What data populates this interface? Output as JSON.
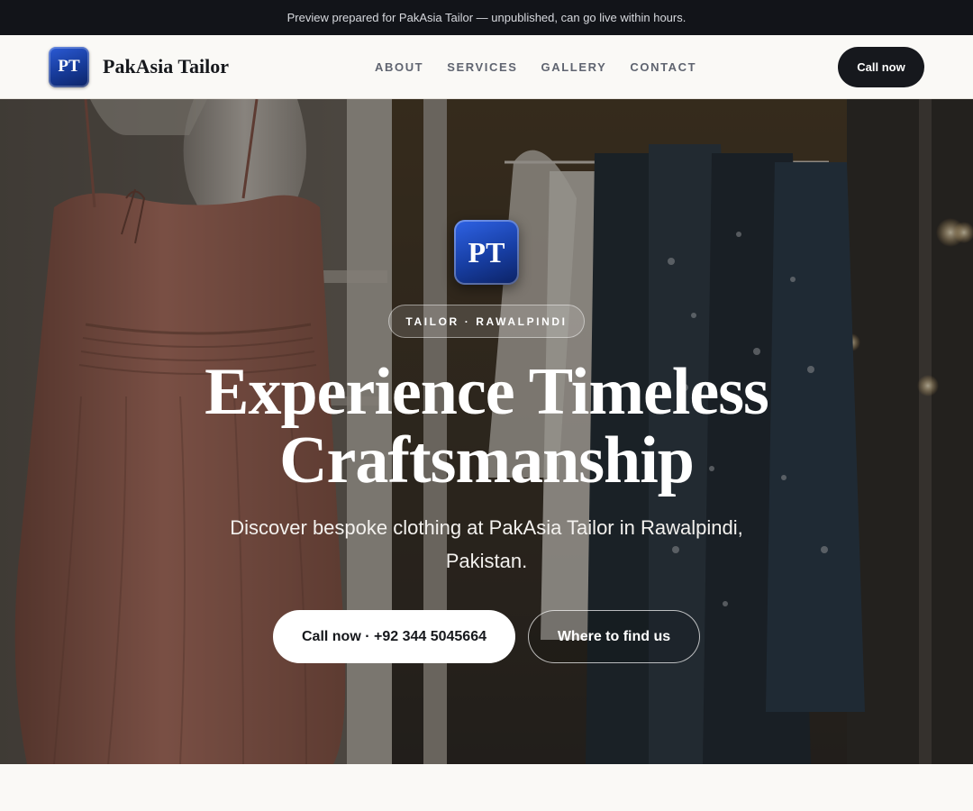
{
  "announcement": "Preview prepared for PakAsia Tailor — unpublished, can go live within hours.",
  "brand": {
    "logo_text": "PT",
    "name": "PakAsia Tailor"
  },
  "nav": {
    "items": [
      "ABOUT",
      "SERVICES",
      "GALLERY",
      "CONTACT"
    ],
    "cta": "Call now"
  },
  "hero": {
    "logo_text": "PT",
    "eyebrow": "TAILOR · RAWALPINDI",
    "headline_line1": "Experience Timeless",
    "headline_line2": "Craftsmanship",
    "subheading": "Discover bespoke clothing at PakAsia Tailor in Rawalpindi, Pakistan.",
    "primary_button": "Call now · +92 344 5045664",
    "secondary_button": "Where to find us",
    "background_image": "dress-on-mannequin-and-clothing-rack"
  },
  "colors": {
    "topbar": "#121419",
    "brand_blue": "#1b45b0",
    "dark_button": "#16181d",
    "page_bg": "#faf9f6"
  }
}
